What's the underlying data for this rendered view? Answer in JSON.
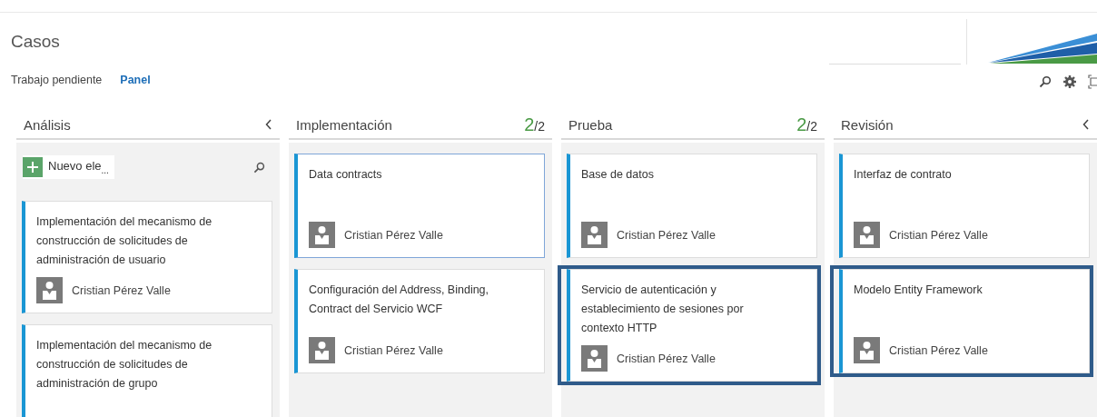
{
  "page_title": "Casos",
  "tabs": [
    {
      "label": "Trabajo pendiente",
      "selected": false
    },
    {
      "label": "Panel",
      "selected": true
    }
  ],
  "columns": [
    {
      "title": "Análisis",
      "collapsible": true,
      "new_item": {
        "label": "Nuevo ele",
        "ellipsis": "..."
      },
      "cards": [
        {
          "title": "Implementación del mecanismo de construcción de solicitudes de administración de usuario",
          "assignee": "Cristian Pérez Valle",
          "selected": false,
          "highlighted": false
        },
        {
          "title": "Implementación del mecanismo de construcción de solicitudes de administración de grupo",
          "selected": false,
          "highlighted": false
        }
      ]
    },
    {
      "title": "Implementación",
      "count": "2",
      "limit": "/2",
      "collapsible": false,
      "cards": [
        {
          "title": "Data contracts",
          "assignee": "Cristian Pérez Valle",
          "selected": true,
          "highlighted": false
        },
        {
          "title": "Configuración del Address, Binding, Contract del Servicio WCF",
          "assignee": "Cristian Pérez Valle",
          "selected": false,
          "highlighted": false
        }
      ]
    },
    {
      "title": "Prueba",
      "count": "2",
      "limit": "/2",
      "collapsible": false,
      "cards": [
        {
          "title": "Base de datos",
          "assignee": "Cristian Pérez Valle",
          "selected": false,
          "highlighted": false
        },
        {
          "title": "Servicio de autenticación y establecimiento de sesiones por contexto HTTP",
          "assignee": "Cristian Pérez Valle",
          "selected": false,
          "highlighted": true
        }
      ]
    },
    {
      "title": "Revisión",
      "collapsible": true,
      "cards": [
        {
          "title": "Interfaz de contrato",
          "assignee": "Cristian Pérez Valle",
          "selected": false,
          "highlighted": false
        },
        {
          "title": "Modelo Entity Framework",
          "assignee": "Cristian Pérez Valle",
          "selected": false,
          "highlighted": true
        }
      ]
    }
  ]
}
